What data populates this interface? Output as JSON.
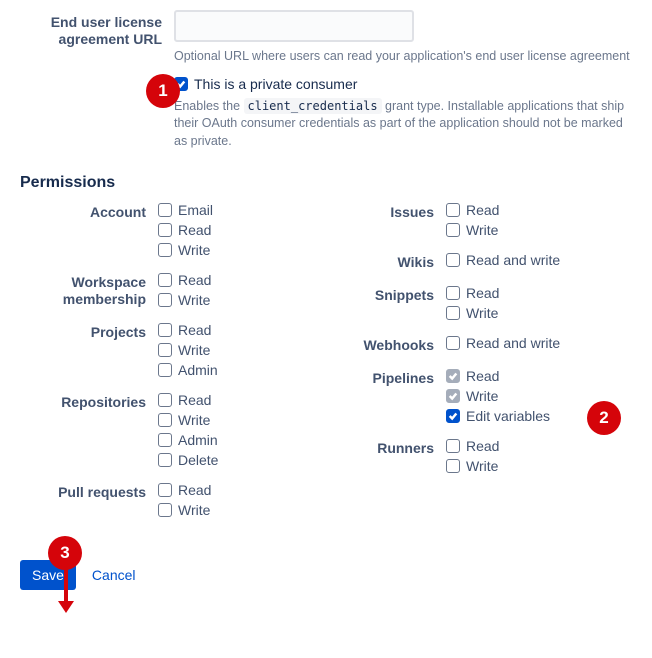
{
  "eula": {
    "label": "End user license agreement URL",
    "value": "",
    "placeholder": "",
    "helper": "Optional URL where users can read your application's end user license agreement"
  },
  "private_consumer": {
    "label": "This is a private consumer",
    "checked": true,
    "helper_pre": "Enables the ",
    "helper_code": "client_credentials",
    "helper_post": " grant type. Installable applications that ship their OAuth consumer credentials as part of the application should not be marked as private."
  },
  "permissions_heading": "Permissions",
  "permissions_left": [
    {
      "label": "Account",
      "options": [
        {
          "label": "Email",
          "checked": false
        },
        {
          "label": "Read",
          "checked": false
        },
        {
          "label": "Write",
          "checked": false
        }
      ]
    },
    {
      "label": "Workspace membership",
      "options": [
        {
          "label": "Read",
          "checked": false
        },
        {
          "label": "Write",
          "checked": false
        }
      ]
    },
    {
      "label": "Projects",
      "options": [
        {
          "label": "Read",
          "checked": false
        },
        {
          "label": "Write",
          "checked": false
        },
        {
          "label": "Admin",
          "checked": false
        }
      ]
    },
    {
      "label": "Repositories",
      "options": [
        {
          "label": "Read",
          "checked": false
        },
        {
          "label": "Write",
          "checked": false
        },
        {
          "label": "Admin",
          "checked": false
        },
        {
          "label": "Delete",
          "checked": false
        }
      ]
    },
    {
      "label": "Pull requests",
      "options": [
        {
          "label": "Read",
          "checked": false
        },
        {
          "label": "Write",
          "checked": false
        }
      ]
    }
  ],
  "permissions_right": [
    {
      "label": "Issues",
      "options": [
        {
          "label": "Read",
          "checked": false
        },
        {
          "label": "Write",
          "checked": false
        }
      ]
    },
    {
      "label": "Wikis",
      "options": [
        {
          "label": "Read and write",
          "checked": false
        }
      ]
    },
    {
      "label": "Snippets",
      "options": [
        {
          "label": "Read",
          "checked": false
        },
        {
          "label": "Write",
          "checked": false
        }
      ]
    },
    {
      "label": "Webhooks",
      "options": [
        {
          "label": "Read and write",
          "checked": false
        }
      ]
    },
    {
      "label": "Pipelines",
      "options": [
        {
          "label": "Read",
          "checked": true,
          "disabled": true
        },
        {
          "label": "Write",
          "checked": true,
          "disabled": true
        },
        {
          "label": "Edit variables",
          "checked": true,
          "disabled": false
        }
      ]
    },
    {
      "label": "Runners",
      "options": [
        {
          "label": "Read",
          "checked": false
        },
        {
          "label": "Write",
          "checked": false
        }
      ]
    }
  ],
  "actions": {
    "save": "Save",
    "cancel": "Cancel"
  },
  "annotations": {
    "1": "1",
    "2": "2",
    "3": "3"
  }
}
